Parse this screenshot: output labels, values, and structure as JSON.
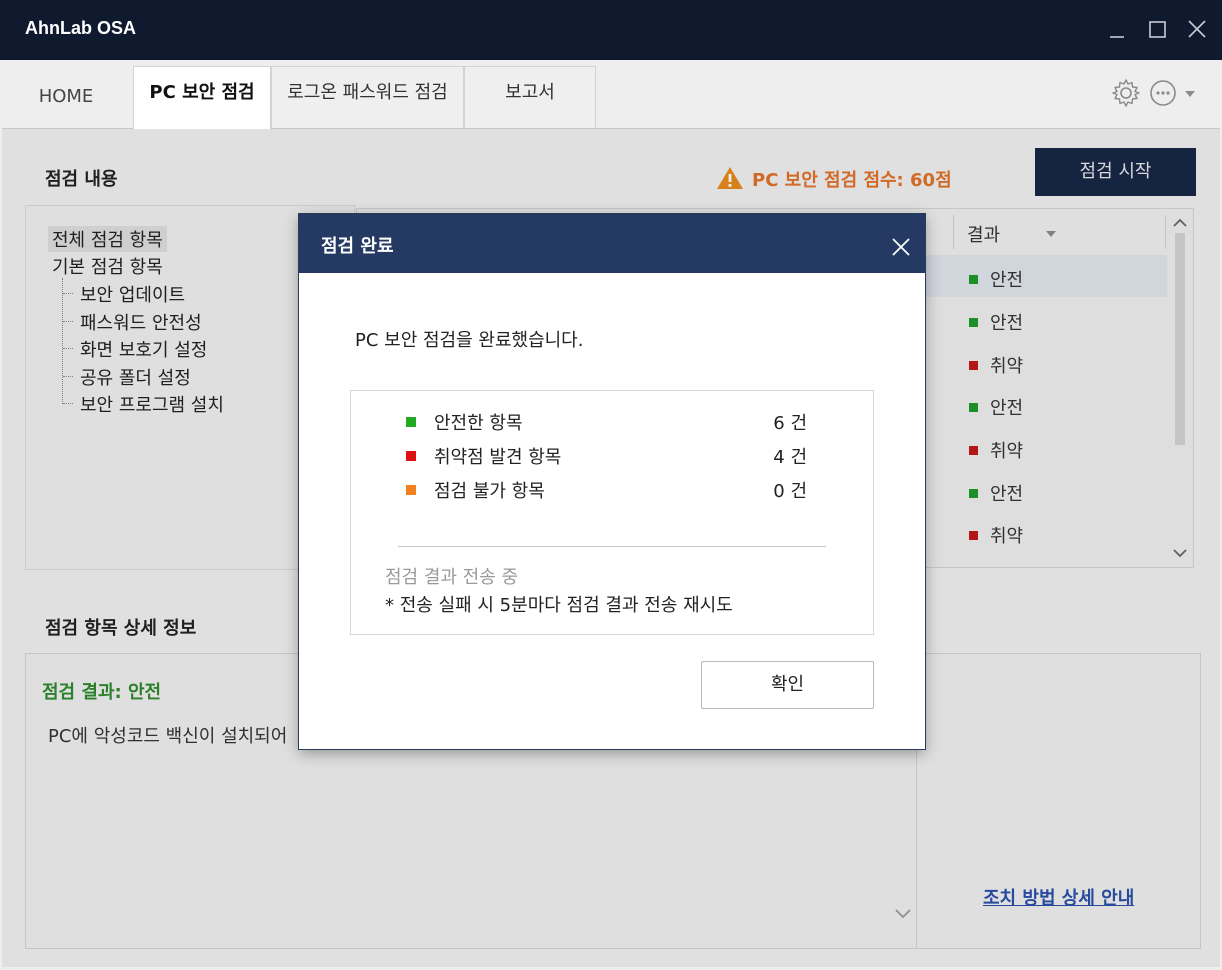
{
  "window": {
    "title": "AhnLab OSA"
  },
  "tabs": [
    {
      "label": "HOME"
    },
    {
      "label": "PC 보안 점검"
    },
    {
      "label": "로그온 패스워드 점검"
    },
    {
      "label": "보고서"
    }
  ],
  "toolbar": {
    "settings_icon": "gear-icon",
    "more_icon": "more-icon"
  },
  "check_content": {
    "title": "점검 내용",
    "tree": {
      "all": "전체 점검 항목",
      "basic": "기본 점검 항목",
      "children": [
        "보안 업데이트",
        "패스워드 안전성",
        "화면 보호기 설정",
        "공유 폴더 설정",
        "보안 프로그램 설치"
      ]
    }
  },
  "score": {
    "label": "PC 보안 점검 점수: 60점",
    "color": "#e0712a"
  },
  "start_button": {
    "label": "점검 시작"
  },
  "results_table": {
    "column": "결과",
    "rows": [
      {
        "status": "안전",
        "color": "#1e9a2a"
      },
      {
        "status": "안전",
        "color": "#1e9a2a"
      },
      {
        "status": "취약",
        "color": "#c01818"
      },
      {
        "status": "안전",
        "color": "#1e9a2a"
      },
      {
        "status": "취약",
        "color": "#c01818"
      },
      {
        "status": "안전",
        "color": "#1e9a2a"
      },
      {
        "status": "취약",
        "color": "#c01818"
      }
    ]
  },
  "detail": {
    "title": "점검 항목 상세 정보",
    "result": "점검 결과: 안전",
    "text": "PC에 악성코드 백신이 설치되어",
    "guide_link": "조치 방법 상세 안내"
  },
  "modal": {
    "title": "점검 완료",
    "message": "PC 보안 점검을 완료했습니다.",
    "summary": [
      {
        "label": "안전한 항목",
        "count": "6 건",
        "color": "#22aa22"
      },
      {
        "label": "취약점 발견 항목",
        "count": "4 건",
        "color": "#dd1111"
      },
      {
        "label": "점검 불가 항목",
        "count": "0 건",
        "color": "#f08020"
      }
    ],
    "sending": "점검 결과 전송 중",
    "retry_note": "* 전송 실패 시 5분마다 점검 결과 전송 재시도",
    "ok_label": "확인"
  }
}
